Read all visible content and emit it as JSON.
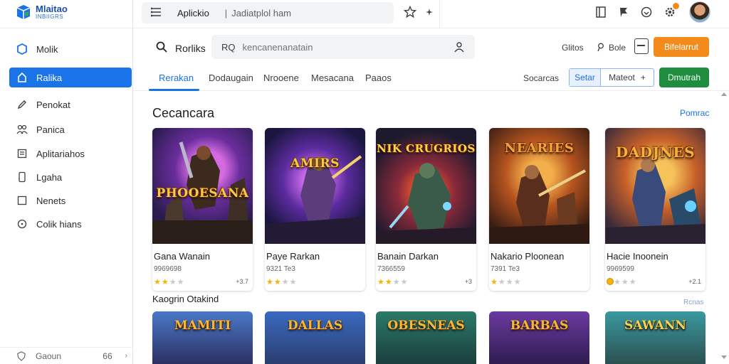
{
  "brand": {
    "title": "Mlaitao",
    "subtitle": "INBIIGRS",
    "accent": "#1a73e8"
  },
  "sidebar": {
    "items": [
      {
        "label": "Molik",
        "icon": "cube-icon"
      },
      {
        "label": "Ralika",
        "icon": "home-icon",
        "active": true
      },
      {
        "label": "Penokat",
        "icon": "pencil-icon"
      },
      {
        "label": "Panica",
        "icon": "group-icon"
      },
      {
        "label": "Aplitariahos",
        "icon": "document-icon"
      },
      {
        "label": "Lgaha",
        "icon": "phone-icon"
      },
      {
        "label": "Nenets",
        "icon": "square-icon"
      },
      {
        "label": "Colik hians",
        "icon": "clock-icon"
      }
    ],
    "footer": {
      "label": "Gaoun",
      "count": "66"
    }
  },
  "topbar": {
    "breadcrumb_app": "Aplickio",
    "breadcrumb_sep": "|",
    "breadcrumb_page": "Jadiatplol ham"
  },
  "searchbar": {
    "label": "Rorliks",
    "prefix": "RQ",
    "placeholder": "kencanenanatain",
    "link_1": "Glitos",
    "link_2": "Bole",
    "orange_button": "Bifelarrut"
  },
  "tabs": {
    "items": [
      "Rerakan",
      "Dodaugain",
      "Nrooene",
      "Mesacana",
      "Paaos"
    ],
    "right_label": "Socarcas",
    "segment_1": "Setar",
    "segment_2": "Mateot",
    "segment_2_suffix": "+",
    "green_button": "Dmutrah"
  },
  "section_1": {
    "title": "Cecancara",
    "link": "Pomrac",
    "cards": [
      {
        "art_title": "PHOOESANA",
        "name": "Gana Wanain",
        "meta": "9969698",
        "rating": 2,
        "count": "+3.7",
        "badge": "star"
      },
      {
        "art_title": "AMIRS",
        "name": "Paye Rarkan",
        "meta": "9321 Te3",
        "rating": 2,
        "count": "",
        "badge": "star"
      },
      {
        "art_title": "NIK CRUGRIOS",
        "name": "Banain Darkan",
        "meta": "7366559",
        "rating": 2,
        "count": "+3",
        "badge": "star"
      },
      {
        "art_title": "NEARIES",
        "name": "Nakario Ploonean",
        "meta": "7391 Te3",
        "rating": 1,
        "count": "",
        "badge": "star"
      },
      {
        "art_title": "DADJNES",
        "name": "Hacie Inoonein",
        "meta": "9969599",
        "rating": 0,
        "count": "+2.1",
        "badge": "coin"
      }
    ]
  },
  "section_2": {
    "title": "Kaogrin Otakind",
    "link": "Rcnas",
    "cards": [
      {
        "art_title": "MAMITI"
      },
      {
        "art_title": "DALLAS"
      },
      {
        "art_title": "OBESNEAS"
      },
      {
        "art_title": "BARBAS"
      },
      {
        "art_title": "SAWANN"
      }
    ]
  }
}
